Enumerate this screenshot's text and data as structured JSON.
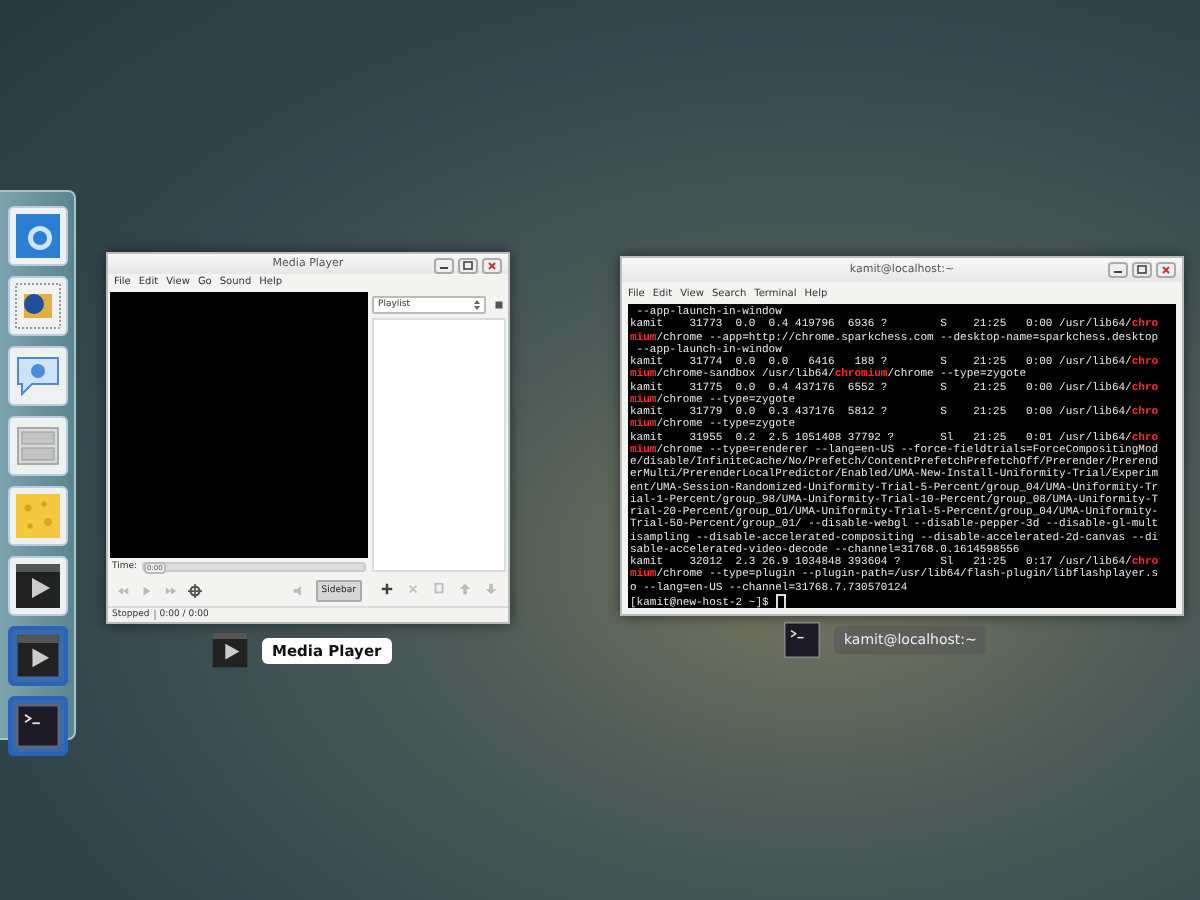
{
  "dock": {
    "items": [
      {
        "kind": "browser",
        "highlighted": false
      },
      {
        "kind": "mail",
        "highlighted": false
      },
      {
        "kind": "chat",
        "highlighted": false
      },
      {
        "kind": "files",
        "highlighted": false
      },
      {
        "kind": "cheese",
        "highlighted": false
      },
      {
        "kind": "video",
        "highlighted": false
      },
      {
        "kind": "video",
        "highlighted": true
      },
      {
        "kind": "terminal",
        "highlighted": true
      }
    ]
  },
  "media_player": {
    "title": "Media Player",
    "menu": [
      "File",
      "Edit",
      "View",
      "Go",
      "Sound",
      "Help"
    ],
    "playlist_select": "Playlist",
    "time_label": "Time:",
    "time_slider": {
      "value": "0:00",
      "level": 0
    },
    "sidebar_button": "Sidebar",
    "status": "Stopped",
    "position": "0:00 / 0:00",
    "caption": "Media Player"
  },
  "terminal": {
    "title": "kamit@localhost:~",
    "menu": [
      "File",
      "Edit",
      "View",
      "Search",
      "Terminal",
      "Help"
    ],
    "caption": "kamit@localhost:~",
    "lines": [
      [
        {
          "text": " --app-launch-in-window",
          "highlight": false
        }
      ],
      [
        {
          "text": "kamit    31773  0.0  0.4 419796  6936 ?        S    21:25   0:00 /usr/lib64/",
          "highlight": false
        },
        {
          "text": "chro",
          "highlight": true
        }
      ],
      [
        {
          "text": "mium",
          "highlight": true
        },
        {
          "text": "/chrome --app=http://chrome.sparkchess.com --desktop-name=sparkchess.desktop",
          "highlight": false
        }
      ],
      [
        {
          "text": " --app-launch-in-window",
          "highlight": false
        }
      ],
      [
        {
          "text": "kamit    31774  0.0  0.0   6416   188 ?        S    21:25   0:00 /usr/lib64/",
          "highlight": false
        },
        {
          "text": "chro",
          "highlight": true
        }
      ],
      [
        {
          "text": "mium",
          "highlight": true
        },
        {
          "text": "/chrome-sandbox /usr/lib64/",
          "highlight": false
        },
        {
          "text": "chromium",
          "highlight": true
        },
        {
          "text": "/chrome --type=zygote",
          "highlight": false
        }
      ],
      [
        {
          "text": "kamit    31775  0.0  0.4 437176  6552 ?        S    21:25   0:00 /usr/lib64/",
          "highlight": false
        },
        {
          "text": "chro",
          "highlight": true
        }
      ],
      [
        {
          "text": "mium",
          "highlight": true
        },
        {
          "text": "/chrome --type=zygote",
          "highlight": false
        }
      ],
      [
        {
          "text": "kamit    31779  0.0  0.3 437176  5812 ?        S    21:25   0:00 /usr/lib64/",
          "highlight": false
        },
        {
          "text": "chro",
          "highlight": true
        }
      ],
      [
        {
          "text": "mium",
          "highlight": true
        },
        {
          "text": "/chrome --type=zygote",
          "highlight": false
        }
      ],
      [
        {
          "text": "kamit    31955  0.2  2.5 1051408 37792 ?       Sl   21:25   0:01 /usr/lib64/",
          "highlight": false
        },
        {
          "text": "chro",
          "highlight": true
        }
      ],
      [
        {
          "text": "mium",
          "highlight": true
        },
        {
          "text": "/chrome --type=renderer --lang=en-US --force-fieldtrials=ForceCompositingMod",
          "highlight": false
        }
      ],
      [
        {
          "text": "e/disable/InfiniteCache/No/Prefetch/ContentPrefetchPrefetchOff/Prerender/Prerend",
          "highlight": false
        }
      ],
      [
        {
          "text": "erMulti/PrerenderLocalPredictor/Enabled/UMA-New-Install-Uniformity-Trial/Experim",
          "highlight": false
        }
      ],
      [
        {
          "text": "ent/UMA-Session-Randomized-Uniformity-Trial-5-Percent/group_04/UMA-Uniformity-Tr",
          "highlight": false
        }
      ],
      [
        {
          "text": "ial-1-Percent/group_98/UMA-Uniformity-Trial-10-Percent/group_08/UMA-Uniformity-T",
          "highlight": false
        }
      ],
      [
        {
          "text": "rial-20-Percent/group_01/UMA-Uniformity-Trial-5-Percent/group_04/UMA-Uniformity-",
          "highlight": false
        }
      ],
      [
        {
          "text": "Trial-50-Percent/group_01/ --disable-webgl --disable-pepper-3d --disable-gl-mult",
          "highlight": false
        }
      ],
      [
        {
          "text": "isampling --disable-accelerated-compositing --disable-accelerated-2d-canvas --di",
          "highlight": false
        }
      ],
      [
        {
          "text": "sable-accelerated-video-decode --channel=31768.0.1614598556",
          "highlight": false
        }
      ],
      [
        {
          "text": "kamit    32012  2.3 26.9 1034848 393604 ?      Sl   21:25   0:17 /usr/lib64/",
          "highlight": false
        },
        {
          "text": "chro",
          "highlight": true
        }
      ],
      [
        {
          "text": "mium",
          "highlight": true
        },
        {
          "text": "/chrome --type=plugin --plugin-path=/usr/lib64/flash-plugin/libflashplayer.s",
          "highlight": false
        }
      ],
      [
        {
          "text": "o --lang=en-US --channel=31768.7.730570124",
          "highlight": false
        }
      ],
      [
        {
          "text": "[kamit@new-host-2 ~]$ ",
          "highlight": false
        }
      ]
    ]
  }
}
